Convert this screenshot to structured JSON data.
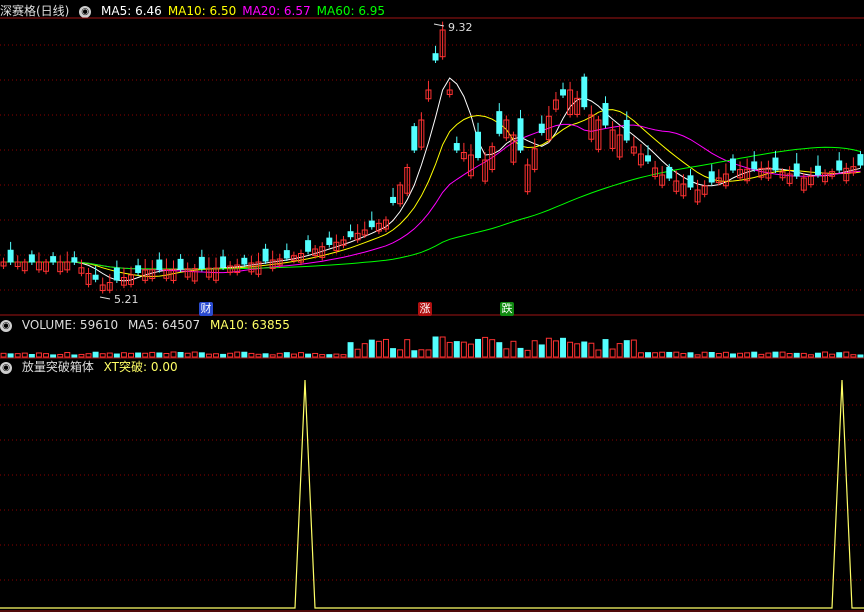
{
  "main": {
    "title": "深赛格(日线)",
    "indicators": [
      {
        "label": "MA5: 6.46",
        "color": "#ffffff"
      },
      {
        "label": "MA10: 6.50",
        "color": "#ffff00"
      },
      {
        "label": "MA20: 6.57",
        "color": "#ff00ff"
      },
      {
        "label": "MA60: 6.95",
        "color": "#00ff00"
      }
    ],
    "high_label": "9.32",
    "low_label": "5.21"
  },
  "badges": {
    "cai": "财",
    "zhang": "涨",
    "die": "跌"
  },
  "volume": {
    "title": "VOLUME: 59610",
    "ma5": "MA5: 64507",
    "ma10": "MA10: 63855"
  },
  "indicator": {
    "title": "放量突破箱体",
    "xt": "XT突破: 0.00",
    "spikes": [
      72,
      623
    ]
  },
  "colors": {
    "up": "#ff3232",
    "down": "#54ffff",
    "ma5": "#ffffff",
    "ma10": "#ffff00",
    "ma20": "#ff00ff",
    "ma60": "#00ff00",
    "grid": "#8b0000"
  },
  "chart_data": {
    "type": "candlestick",
    "series": [
      {
        "name": "MA5",
        "value": 6.46
      },
      {
        "name": "MA10",
        "value": 6.5
      },
      {
        "name": "MA20",
        "value": 6.57
      },
      {
        "name": "MA60",
        "value": 6.95
      }
    ],
    "high": 9.32,
    "low": 5.21
  }
}
